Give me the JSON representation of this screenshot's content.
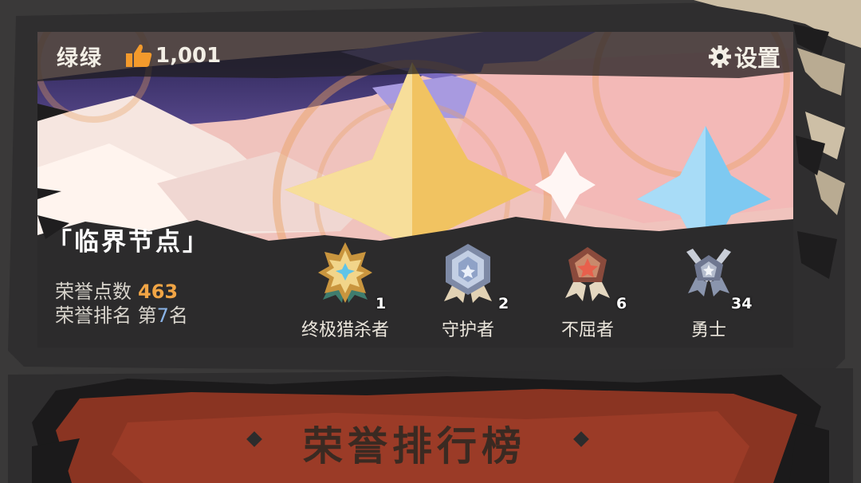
{
  "player": {
    "name": "绿绿",
    "likes": "1,001"
  },
  "settings": {
    "label": "设置",
    "icon": "gear-icon"
  },
  "title": {
    "text": "「临界节点」"
  },
  "stats": {
    "honor_points_label": "荣誉点数",
    "honor_points_value": "463",
    "rank_label": "荣誉排名",
    "rank_prefix": "第",
    "rank_value": "7",
    "rank_suffix": "名"
  },
  "medals": [
    {
      "name": "终极猎杀者",
      "count": "1",
      "icon": "gold-star-medal-icon"
    },
    {
      "name": "守护者",
      "count": "2",
      "icon": "silver-hexagon-medal-icon"
    },
    {
      "name": "不屈者",
      "count": "6",
      "icon": "bronze-pentagon-medal-icon"
    },
    {
      "name": "勇士",
      "count": "34",
      "icon": "silver-crossed-swords-medal-icon"
    }
  ],
  "leaderboard_banner": {
    "title": "荣誉排行榜"
  },
  "colors": {
    "background": "#3a3939",
    "honor_points_accent": "#f1a545",
    "rank_accent": "#8ab4e8",
    "banner_red": "#8a3422",
    "text_light": "#f3efe6"
  }
}
